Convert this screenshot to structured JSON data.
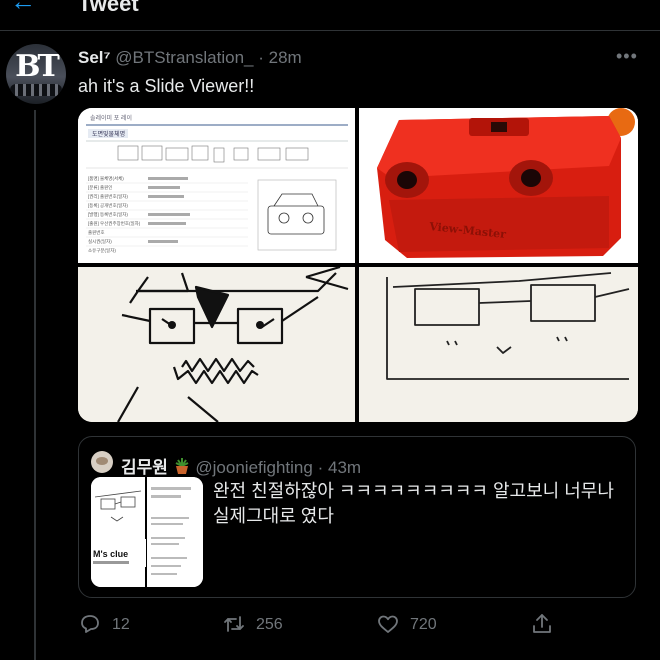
{
  "header": {
    "title": "Tweet",
    "back_icon": "back-arrow-icon",
    "accent": "#1d9bf0"
  },
  "tweet": {
    "author_name": "Sel⁷",
    "handle": "@BTStranslation_",
    "separator": "·",
    "time": "28m",
    "avatar_text": "BT",
    "text": "ah it's a Slide Viewer!!",
    "more_icon": "more-horizontal-icon"
  },
  "media": {
    "images": [
      {
        "name": "document-scan",
        "heading": "솔레이미 포 레이",
        "subheading": "도면및물체명",
        "table_rows": [
          "[품명] 물체명(서체)",
          "[분류] 출원인",
          "[권리] 출원번호(일자)",
          "[등록] 공개번호(일자)",
          "[발행] 등록번호(일자)",
          "[출원] 우선권주장번호(일자)",
          "출원번호",
          "실시권(일자)",
          "소유구분(일자)"
        ]
      },
      {
        "name": "red-view-master-toy",
        "brand_text": "View-Master",
        "color": "#d81e10"
      },
      {
        "name": "drawing-angry-face"
      },
      {
        "name": "drawing-calm-face"
      }
    ]
  },
  "quote": {
    "author_name": "김무원",
    "emoji_icon": "potted-plant-icon",
    "handle": "@jooniefighting",
    "separator": "·",
    "time": "43m",
    "text": "완전 친절하잖아 ㅋㅋㅋㅋㅋㅋㅋㅋㅋ 알고보니 너무나 실제그대로 였다",
    "thumb_caption": "M's clue"
  },
  "actions": {
    "replies": "12",
    "retweets": "256",
    "likes": "720",
    "icons": [
      "reply-icon",
      "retweet-icon",
      "like-icon",
      "share-icon"
    ]
  },
  "colors": {
    "background": "#000000",
    "text": "#e7e9ea",
    "muted": "#71767b",
    "border": "#2f3336"
  }
}
